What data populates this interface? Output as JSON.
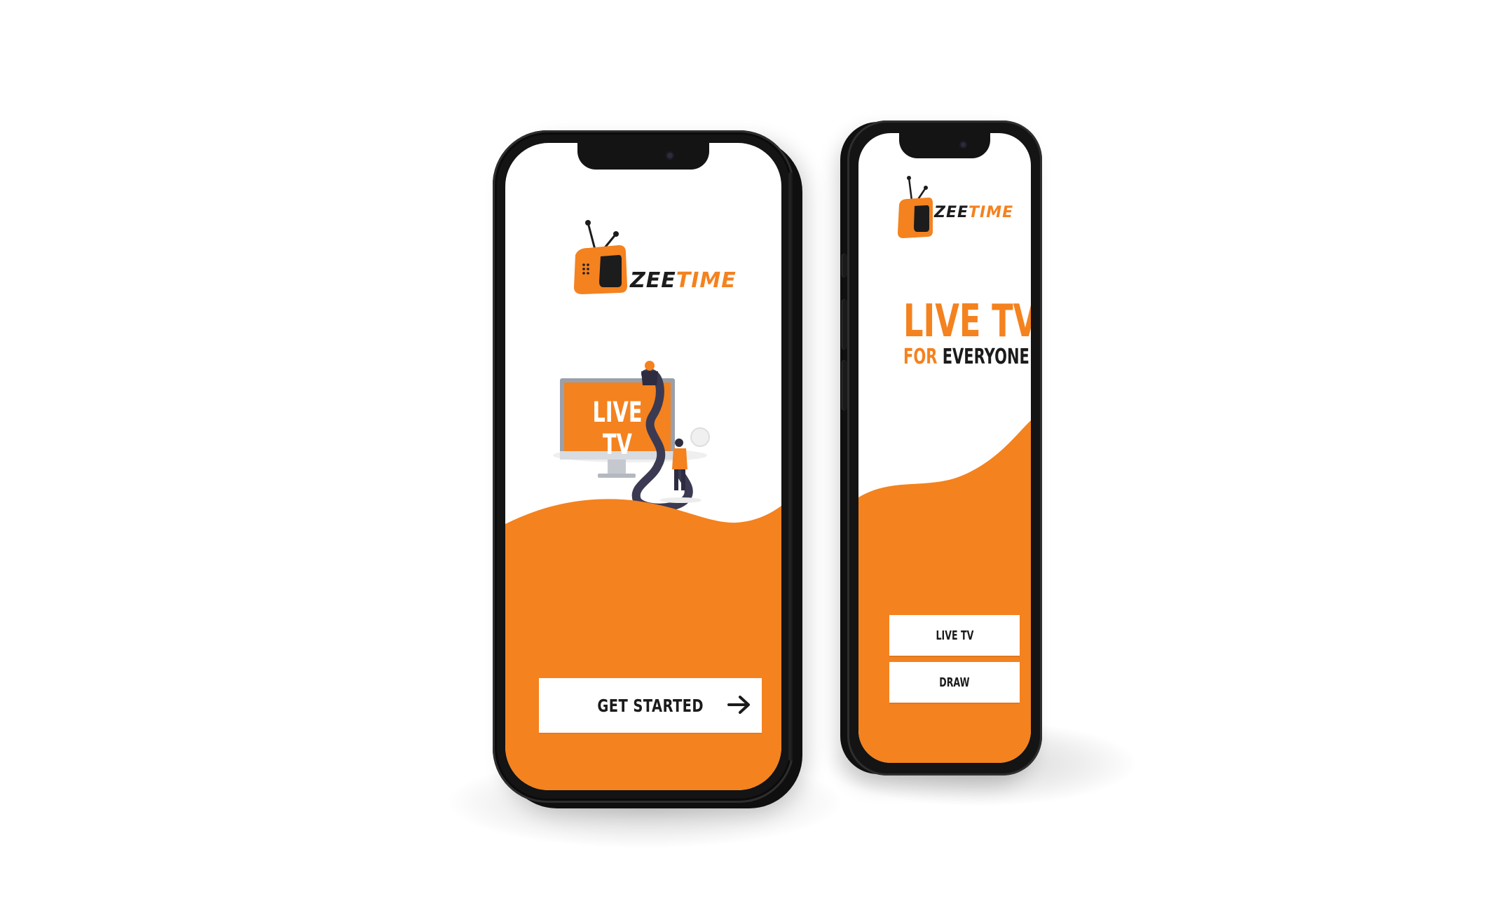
{
  "brand": {
    "name_part1": "ZEE",
    "name_part2": "TIME",
    "accent_color": "#f4821f",
    "dark_color": "#1c1c1c"
  },
  "screen_welcome": {
    "illustration_text": "LIVE TV",
    "get_started_label": "GET STARTED",
    "get_started_icon": "arrow-right-icon"
  },
  "screen_menu": {
    "headline_main": "LIVE TV",
    "headline_for": "FOR",
    "headline_everyone": "EVERYONE",
    "menu_items": [
      {
        "label": "LIVE TV"
      },
      {
        "label": "DRAW"
      }
    ]
  }
}
